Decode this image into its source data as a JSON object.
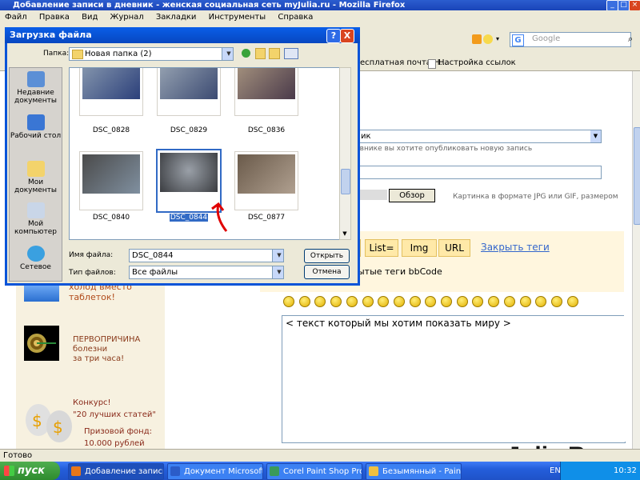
{
  "browser": {
    "title": "Добавление записи в дневник - женская социальная сеть myJulia.ru - Mozilla Firefox",
    "menu": [
      "Файл",
      "Правка",
      "Вид",
      "Журнал",
      "Закладки",
      "Инструменты",
      "Справка"
    ],
    "search_placeholder": "Google",
    "bookmarks": [
      "есплатная почта Н...",
      "Настройка ссылок"
    ],
    "status": "Готово"
  },
  "page": {
    "select_value": "ик",
    "select_hint": "дневнике вы хотите опубликовать новую запись",
    "browse_label": "Обзор",
    "image_hint": "Картинка в формате JPG или GIF, размером",
    "bbcode_buttons": [
      "List=",
      "Img",
      "URL"
    ],
    "close_tags": "Закрыть теги",
    "bbcode_note": "рытые теги bbCode",
    "editor_text": "< текст который мы хотим показать миру >",
    "left_promos": [
      {
        "lines": [
          "холод вместо",
          "таблеток!"
        ]
      },
      {
        "lines": [
          "ПЕРВОПРИЧИНА",
          "болезни",
          "за три часа!"
        ]
      },
      {
        "lines": [
          "Конкурс!",
          "\"20 лучших статей\"",
          "Призовой фонд:",
          "10.000 рублей"
        ]
      }
    ],
    "watermark": "myJulia.Ru"
  },
  "dialog": {
    "title": "Загрузка файла",
    "folder_label": "Папка:",
    "folder_value": "Новая папка (2)",
    "places": [
      "Недавние документы",
      "Рабочий стол",
      "Мои документы",
      "Мой компьютер",
      "Сетевое"
    ],
    "files": [
      "DSC_0828",
      "DSC_0829",
      "DSC_0836",
      "DSC_0840",
      "DSC_0844",
      "DSC_0877"
    ],
    "selected_file": "DSC_0844",
    "filename_label": "Имя файла:",
    "filename_value": "DSC_0844",
    "filetype_label": "Тип файлов:",
    "filetype_value": "Все файлы",
    "open_button": "Открыть",
    "cancel_button": "Отмена",
    "help_button": "?",
    "close_button": "X"
  },
  "taskbar": {
    "start": "пуск",
    "tasks": [
      "Добавление записи ...",
      "Документ Microsoft ...",
      "Corel Paint Shop Pro ...",
      "Безымянный - Paint"
    ],
    "lang": "EN",
    "time": "10:32"
  },
  "colors": {
    "xp_blue": "#0a54d8",
    "selection": "#316ac5",
    "bbcode_bg": "#ffe9a8",
    "promo_text": "#b04a1a",
    "annotation_arrow": "#e00000"
  }
}
